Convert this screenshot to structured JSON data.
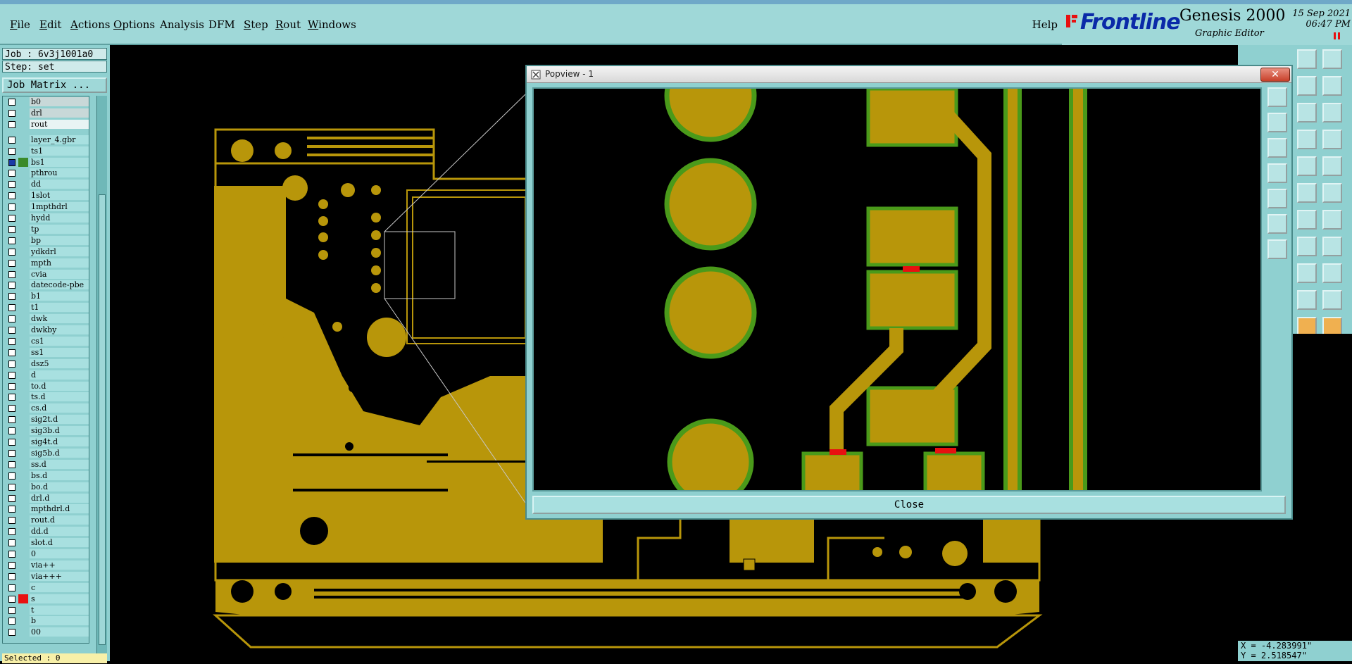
{
  "window": {
    "title": "Graphic Editor"
  },
  "menu": {
    "items": [
      {
        "id": "file",
        "first": "F",
        "rest": "ile"
      },
      {
        "id": "edit",
        "first": "E",
        "rest": "dit"
      },
      {
        "id": "actions",
        "first": "A",
        "rest": "ctions"
      },
      {
        "id": "options",
        "first": "O",
        "rest": "ptions"
      },
      {
        "id": "analysis",
        "first": "",
        "rest": "Analysis"
      },
      {
        "id": "dfm",
        "first": "",
        "rest": "DFM"
      },
      {
        "id": "step",
        "first": "S",
        "rest": "tep"
      },
      {
        "id": "rout",
        "first": "R",
        "rest": "out"
      },
      {
        "id": "windows",
        "first": "W",
        "rest": "indows"
      }
    ],
    "help": "Help"
  },
  "brand": {
    "logo": "Frontline",
    "product": "Genesis 2000",
    "subtitle": "Graphic Editor",
    "date": "15 Sep 2021",
    "time": "06:47 PM"
  },
  "panel": {
    "job": "Job : 6v3j1001a0",
    "step": "Step: set",
    "job_matrix": "Job Matrix ...",
    "selected": "Selected : 0"
  },
  "layers": [
    {
      "name": "b0",
      "state": "gray"
    },
    {
      "name": "drl",
      "state": "gray"
    },
    {
      "name": "rout",
      "state": "sel"
    },
    {
      "name": "layer_4.gbr",
      "state": ""
    },
    {
      "name": "ts1",
      "state": ""
    },
    {
      "name": "bs1",
      "state": "active",
      "swatch": "#3a8a2a",
      "box": "#1a3aa8"
    },
    {
      "name": "pthrou",
      "state": ""
    },
    {
      "name": "dd",
      "state": ""
    },
    {
      "name": "1slot",
      "state": ""
    },
    {
      "name": "1mpthdrl",
      "state": ""
    },
    {
      "name": "hydd",
      "state": ""
    },
    {
      "name": "tp",
      "state": ""
    },
    {
      "name": "bp",
      "state": ""
    },
    {
      "name": "ydkdrl",
      "state": ""
    },
    {
      "name": "mpth",
      "state": ""
    },
    {
      "name": "cvia",
      "state": ""
    },
    {
      "name": "datecode-pbe",
      "state": ""
    },
    {
      "name": "b1",
      "state": ""
    },
    {
      "name": "t1",
      "state": ""
    },
    {
      "name": "dwk",
      "state": ""
    },
    {
      "name": "dwkby",
      "state": ""
    },
    {
      "name": "cs1",
      "state": ""
    },
    {
      "name": "ss1",
      "state": ""
    },
    {
      "name": "dsz5",
      "state": ""
    },
    {
      "name": "d",
      "state": ""
    },
    {
      "name": "to.d",
      "state": ""
    },
    {
      "name": "ts.d",
      "state": ""
    },
    {
      "name": "cs.d",
      "state": ""
    },
    {
      "name": "sig2t.d",
      "state": ""
    },
    {
      "name": "sig3b.d",
      "state": ""
    },
    {
      "name": "sig4t.d",
      "state": ""
    },
    {
      "name": "sig5b.d",
      "state": ""
    },
    {
      "name": "ss.d",
      "state": ""
    },
    {
      "name": "bs.d",
      "state": ""
    },
    {
      "name": "bo.d",
      "state": ""
    },
    {
      "name": "drl.d",
      "state": ""
    },
    {
      "name": "mpthdrl.d",
      "state": ""
    },
    {
      "name": "rout.d",
      "state": ""
    },
    {
      "name": "dd.d",
      "state": ""
    },
    {
      "name": "slot.d",
      "state": ""
    },
    {
      "name": "0",
      "state": ""
    },
    {
      "name": "via++",
      "state": ""
    },
    {
      "name": "via+++",
      "state": ""
    },
    {
      "name": "c",
      "state": ""
    },
    {
      "name": "s",
      "state": "",
      "swatch": "#e81010"
    },
    {
      "name": "t",
      "state": ""
    },
    {
      "name": "b",
      "state": ""
    },
    {
      "name": "00",
      "state": ""
    }
  ],
  "popview": {
    "title": "Popview - 1",
    "close_label": "Close"
  },
  "coords": {
    "x": "X = -4.283991\"",
    "y": "Y =  2.518547\""
  },
  "colors": {
    "copper": "#b8960a",
    "mask": "#4a9a1a",
    "highlight": "#e81010",
    "panel": "#8fd0d0"
  }
}
